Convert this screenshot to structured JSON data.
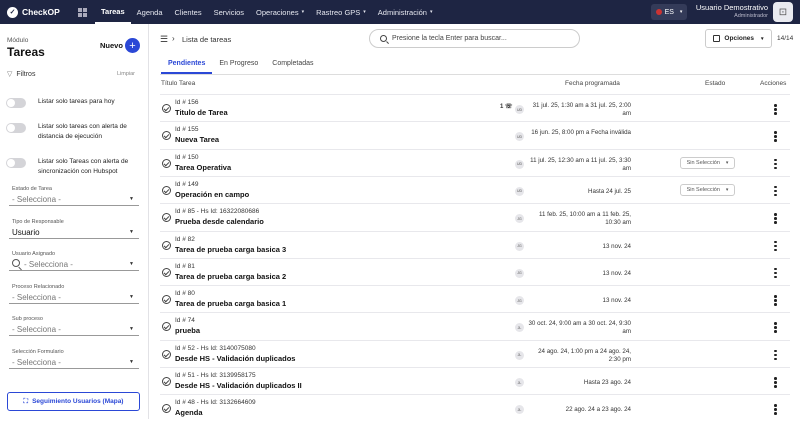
{
  "app": {
    "logo": "CheckOP",
    "logo_mark": "✓"
  },
  "nav": [
    {
      "label": "Tareas",
      "active": true,
      "caret": ""
    },
    {
      "label": "Agenda",
      "active": false,
      "caret": ""
    },
    {
      "label": "Clientes",
      "active": false,
      "caret": ""
    },
    {
      "label": "Servicios",
      "active": false,
      "caret": ""
    },
    {
      "label": "Operaciones",
      "active": false,
      "caret": "▾"
    },
    {
      "label": "Rastreo GPS",
      "active": false,
      "caret": "▾"
    },
    {
      "label": "Administración",
      "active": false,
      "caret": "▾"
    }
  ],
  "lang": {
    "code": "ES",
    "caret": "▾"
  },
  "user": {
    "name": "Usuario Demostrativo",
    "role": "Administrador",
    "avatar": "⊡"
  },
  "sidebar": {
    "module_label": "Módulo",
    "module_title": "Tareas",
    "new_label": "Nuevo",
    "new_icon": "+",
    "filters_label": "Filtros",
    "clear_label": "Limpiar",
    "toggles": [
      {
        "label": "Listar solo tareas para hoy"
      },
      {
        "label": "Listar solo tareas con alerta de distancia de ejecución"
      },
      {
        "label": "Listar solo Tareas con alerta de sincronización con Hubspot"
      }
    ],
    "fields": [
      {
        "label": "Estado de Tarea",
        "value": "- Selecciona -",
        "search": false,
        "dark": false
      },
      {
        "label": "Tipo de Responsable",
        "value": "Usuario",
        "search": false,
        "dark": true
      },
      {
        "label": "Usuario Asignado",
        "value": "- Selecciona -",
        "search": true,
        "dark": false
      },
      {
        "label": "Proceso Relacionado",
        "value": "- Selecciona -",
        "search": false,
        "dark": false
      },
      {
        "label": "Sub proceso",
        "value": "- Selecciona -",
        "search": false,
        "dark": false
      },
      {
        "label": "Selección Formulario",
        "value": "- Selecciona -",
        "search": false,
        "dark": false
      }
    ],
    "map_button": "Seguimiento Usuarios (Mapa)"
  },
  "main": {
    "breadcrumb": "Lista de tareas",
    "search_placeholder": "Presione la tecla Enter para buscar...",
    "options_label": "Opciones",
    "count": "14/14",
    "tabs": [
      {
        "label": "Pendientes",
        "active": true
      },
      {
        "label": "En Progreso",
        "active": false
      },
      {
        "label": "Completadas",
        "active": false
      }
    ],
    "headers": {
      "title": "Título Tarea",
      "date": "Fecha programada",
      "state": "Estado",
      "actions": "Acciones"
    },
    "rows": [
      {
        "id": "Id # 156",
        "title": "Titulo de Tarea",
        "badge": "1 ☏",
        "initials": "UD",
        "date": "31 jul. 25, 1:30 am a 31 jul. 25, 2:00 am",
        "state": ""
      },
      {
        "id": "Id # 155",
        "title": "Nueva Tarea",
        "badge": "",
        "initials": "UD",
        "date": "16 jun. 25, 8:00 pm a Fecha inválida",
        "state": ""
      },
      {
        "id": "Id # 150",
        "title": "Tarea Operativa",
        "badge": "",
        "initials": "UD",
        "date": "11 jul. 25, 12:30 am a 11 jul. 25, 3:30 am",
        "state": "Sin Selección"
      },
      {
        "id": "Id # 149",
        "title": "Operación en campo",
        "badge": "",
        "initials": "UD",
        "date": "Hasta 24 jul. 25",
        "state": "Sin Selección"
      },
      {
        "id": "Id # 85 - Hs Id: 16322080686",
        "title": "Prueba desde calendario",
        "badge": "",
        "initials": "JG",
        "date": "11 feb. 25, 10:00 am a 11 feb. 25, 10:30 am",
        "state": ""
      },
      {
        "id": "Id # 82",
        "title": "Tarea de prueba carga basica 3",
        "badge": "",
        "initials": "JG",
        "date": "13 nov. 24",
        "state": ""
      },
      {
        "id": "Id # 81",
        "title": "Tarea de prueba carga basica 2",
        "badge": "",
        "initials": "JG",
        "date": "13 nov. 24",
        "state": ""
      },
      {
        "id": "Id # 80",
        "title": "Tarea de prueba carga basica 1",
        "badge": "",
        "initials": "JG",
        "date": "13 nov. 24",
        "state": ""
      },
      {
        "id": "Id # 74",
        "title": "prueba",
        "badge": "",
        "initials": "JL",
        "date": "30 oct. 24, 9:00 am a 30 oct. 24, 9:30 am",
        "state": ""
      },
      {
        "id": "Id # 52 - Hs Id: 3140075080",
        "title": "Desde HS - Validación duplicados",
        "badge": "",
        "initials": "JL",
        "date": "24 ago. 24, 1:00 pm a 24 ago. 24, 2:30 pm",
        "state": ""
      },
      {
        "id": "Id # 51 - Hs Id: 3139958175",
        "title": "Desde HS - Validación duplicados II",
        "badge": "",
        "initials": "JL",
        "date": "Hasta 23 ago. 24",
        "state": ""
      },
      {
        "id": "Id # 48 - Hs Id: 3132664609",
        "title": "Agenda",
        "badge": "",
        "initials": "JL",
        "date": "22 ago. 24 a 23 ago. 24",
        "state": ""
      }
    ]
  }
}
